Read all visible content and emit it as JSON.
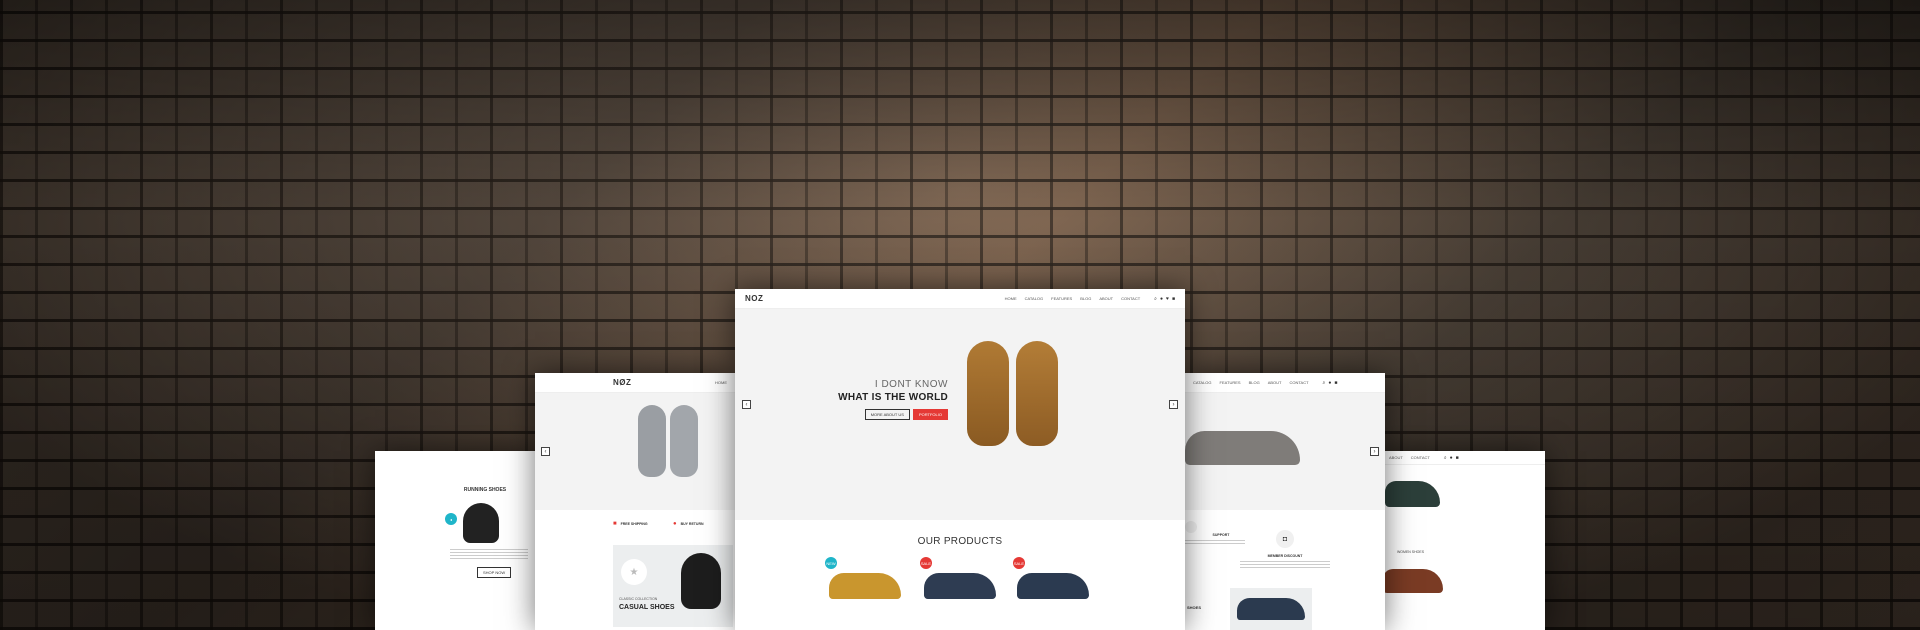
{
  "hero": {
    "headline_1": "I DONT KNOW",
    "headline_2": "WHAT IS THE WORLD",
    "btn_primary": "MORE ABOUT US",
    "btn_secondary": "PORTFOLIO"
  },
  "nav": {
    "logo": "NOZ",
    "items": [
      "HOME",
      "CATALOG",
      "FEATURES",
      "BLOG",
      "ABOUT",
      "CONTACT"
    ]
  },
  "products": {
    "title": "OUR PRODUCTS",
    "badges": [
      "NEW",
      "SALE",
      "SALE"
    ]
  },
  "left_page": {
    "title": "RUNNING SHOES",
    "cta": "SHOP NOW",
    "feature_1": "FREE SHIPPING",
    "feature_2": "BUY RETURN",
    "promo_small": "CLASSIC COLLECTION",
    "promo_title": "CASUAL SHOES"
  },
  "right_page": {
    "support": "SUPPORT",
    "discount": "MEMBER DISCOUNT",
    "label_1": "SHOES",
    "label_2": "WOMEN SHOES"
  },
  "colors": {
    "accent": "#e53935",
    "teal": "#1fb5c9"
  }
}
